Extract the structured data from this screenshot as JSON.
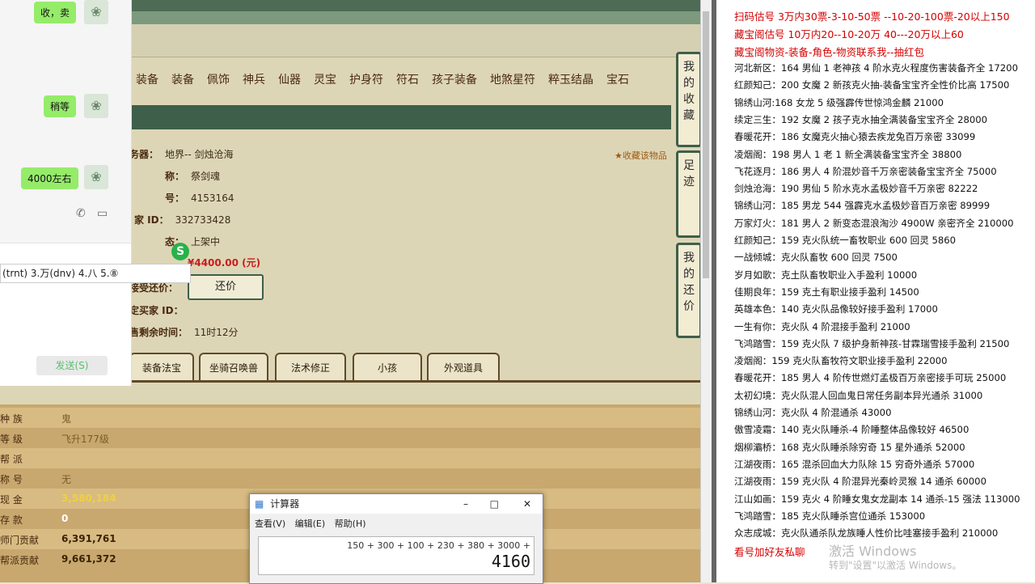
{
  "game": {
    "categories": [
      "装备",
      "装备",
      "佩饰",
      "神兵",
      "仙器",
      "灵宝",
      "护身符",
      "符石",
      "孩子装备",
      "地煞星符",
      "粹玉结晶",
      "宝石"
    ],
    "info": [
      {
        "label": "务器：",
        "value": "地界-- 剑烛沧海"
      },
      {
        "label": "称：",
        "value": "祭剑魂"
      },
      {
        "label": "号：",
        "value": "4153164"
      },
      {
        "label": "家  ID：",
        "value": "332733428"
      },
      {
        "label": "态：",
        "value": "上架中"
      },
      {
        "label": "",
        "value": "¥4400.00 (元)"
      },
      {
        "label": "接受还价：",
        "value": ""
      },
      {
        "label": "定买家 ID：",
        "value": ""
      },
      {
        "label": "售剩余时间：",
        "value": "11时12分"
      }
    ],
    "counter_offer": "还价",
    "collect": "收藏该物品",
    "side_tabs": [
      "我的收藏",
      "足迹",
      "我的还价"
    ],
    "tabs": [
      "装备法宝",
      "坐骑召唤兽",
      "法术修正",
      "小孩",
      "外观道具"
    ],
    "stats": [
      {
        "label": "种  族",
        "value": "鬼"
      },
      {
        "label": "等  级",
        "value": "飞升177级"
      },
      {
        "label": "帮  派",
        "value": ""
      },
      {
        "label": "称  号",
        "value": "无"
      },
      {
        "label": "现  金",
        "value": "3,580,184"
      },
      {
        "label": "存  款",
        "value": "0"
      },
      {
        "label": "师门贡献",
        "value": "6,391,761"
      },
      {
        "label": "帮派贡献",
        "value": "9,661,372"
      }
    ]
  },
  "chat": {
    "messages": [
      "收，卖",
      "稍等",
      "4000左右"
    ],
    "ime": "(trnt) 3.万(dnv) 4.八 5.⑧",
    "send": "发送(S)"
  },
  "calculator": {
    "title": "计算器",
    "menu": [
      "查看(V)",
      "编辑(E)",
      "帮助(H)"
    ],
    "expression": "150 + 300 + 100 + 230 + 380 + 3000 +",
    "result": "4160"
  },
  "doc": {
    "header_lines": [
      "扫码估号 3万内30票-3-10-50票 --10-20-100票-20以上150",
      "藏宝阁估号 10万内20--10-20万 40---20万以上60",
      "藏宝阁物资-装备-角色-物资联系我--抽红包"
    ],
    "lines": [
      "河北新区：164 男仙 1 老神孩 4 阶水克火程度伤害装备齐全 17200",
      "红颜知己：200 女魔 2 新孩克火抽-装备宝宝齐全性价比高 17500",
      "锦绣山河:168 女龙 5 级强霹传世惊鸿金麟 21000",
      "续定三生：192 女魔 2 孩子克水抽全满装备宝宝齐全 28000",
      "春暖花开：186 女魔克火抽心猿去疾龙兔百万亲密 33099",
      "凌烟阁：198 男人 1 老 1 新全满装备宝宝齐全 38800",
      "飞花逐月：186 男人 4 阶混妙音千万亲密装备宝宝齐全 75000",
      "剑烛沧海：190 男仙 5 阶水克水孟极妙音千万亲密 82222",
      "锦绣山河：185 男龙 544 强霹克水孟极妙音百万亲密 89999",
      "万家灯火：181 男人 2 新变态混浪淘沙 4900W 亲密齐全 210000",
      "红颜知己：159 克火队统一畜牧职业 600 回灵 5860",
      "一战倾城：克火队畜牧 600 回灵 7500",
      "岁月如歌：克土队畜牧职业入手盈利 10000",
      "佳期良年：159 克土有职业接手盈利 14500",
      "英雄本色：140 克火队品像较好接手盈利 17000",
      "一生有你：克火队 4 阶混接手盈利 21000",
      "飞鸿踏雪：159 克火队 7 级护身新神孩-甘霖瑞雪接手盈利 21500",
      "凌烟阁：159 克火队畜牧符文职业接手盈利 22000",
      "春暖花开：185 男人 4 阶传世燃灯孟极百万亲密接手可玩 25000",
      "太初幻境：克火队混人回血鬼日常任务副本异光通杀 31000",
      "锦绣山河：克火队 4 阶混通杀 43000",
      "傲雪凌霜：140 克火队睡杀-4 阶睡整体品像较好 46500",
      "烟柳灞桥：168 克火队睡杀除穷奇 15 星外通杀 52000",
      "江湖夜雨：165 混杀回血大力队除 15 穷奇外通杀 57000",
      "江湖夜雨：159 克火队 4 阶混异光秦岭灵猴 14 通杀 60000",
      "江山如画：159 克火 4 阶睡女鬼女龙副本 14 通杀-15 强法 113000",
      "飞鸿踏雪：185 克火队睡杀宫位通杀 153000",
      "众志成城：克火队通杀队龙族睡人性价比哇塞接手盈利 210000"
    ],
    "footer": "看号加好友私聊",
    "watermark1": "激活 Windows",
    "watermark2": "转到\"设置\"以激活 Windows。"
  }
}
